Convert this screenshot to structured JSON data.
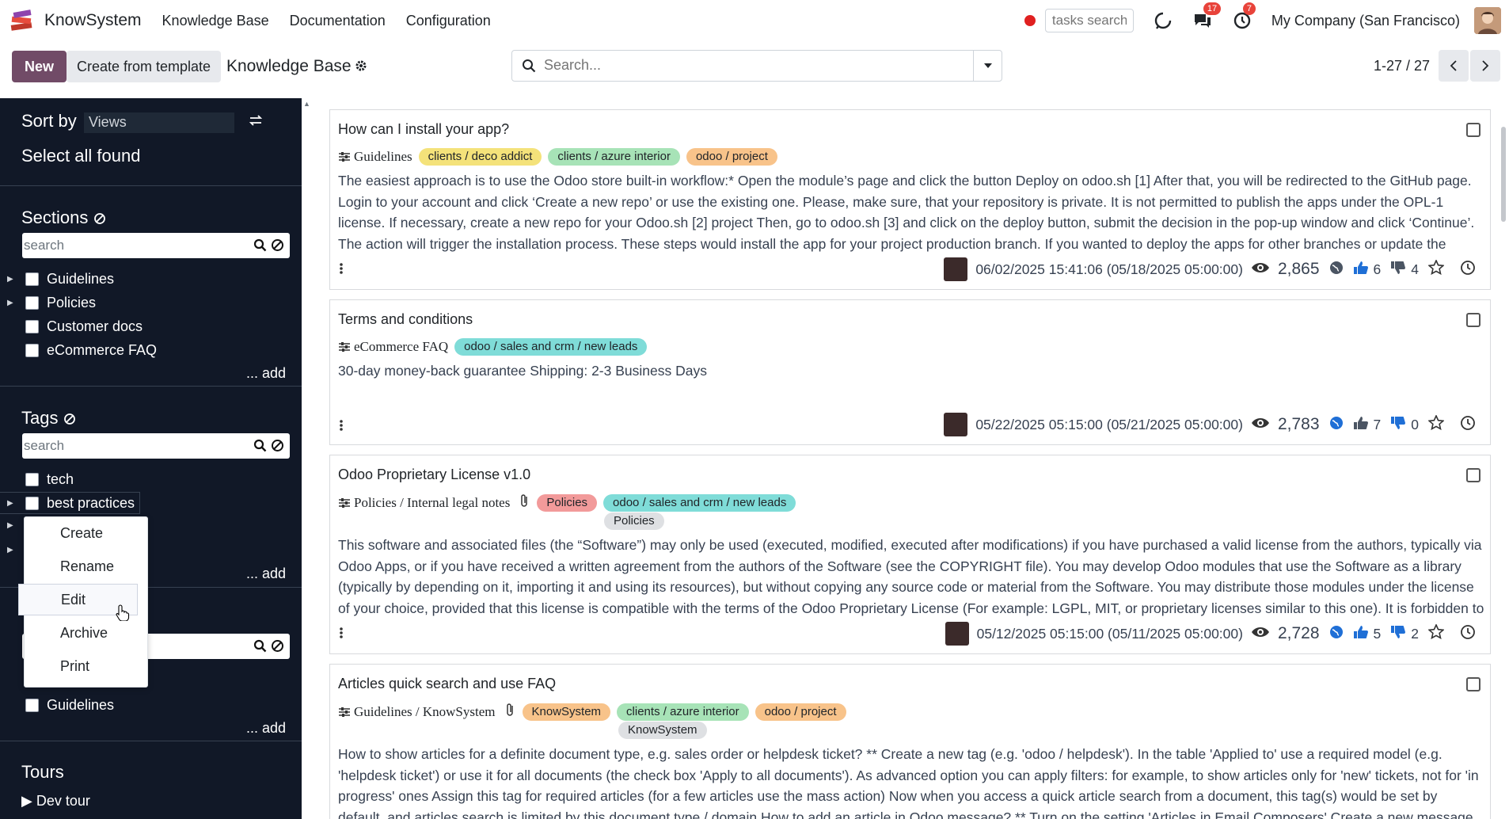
{
  "navbar": {
    "app_name": "KnowSystem",
    "menu": [
      "Knowledge Base",
      "Documentation",
      "Configuration"
    ],
    "tasks_search_placeholder": "tasks search",
    "messages_badge": "17",
    "activities_badge": "7",
    "company": "My Company (San Francisco)"
  },
  "control_panel": {
    "new_label": "New",
    "template_label": "Create from template",
    "breadcrumb": "Knowledge Base",
    "search_placeholder": "Search...",
    "pager": "1-27 / 27"
  },
  "sidebar": {
    "sort_by_label": "Sort by",
    "sort_value": "Views",
    "select_all": "Select all found",
    "sections": {
      "title": "Sections",
      "search_placeholder": "search",
      "items": [
        "Guidelines",
        "Policies",
        "Customer docs",
        "eCommerce FAQ"
      ],
      "add": "... add"
    },
    "tags": {
      "title": "Tags",
      "search_placeholder": "search",
      "items": [
        "tech",
        "best practices"
      ],
      "add": "... add"
    },
    "types": {
      "items": [
        "Guidelines"
      ],
      "add": "... add"
    },
    "tours": {
      "title": "Tours",
      "items": [
        "▶ Dev tour"
      ]
    },
    "context_menu": [
      "Create",
      "Rename",
      "Edit",
      "Archive",
      "Print"
    ]
  },
  "articles": [
    {
      "title": "How can I install your app?",
      "section": "Guidelines",
      "tags": [
        "clients / deco addict",
        "clients / azure interior",
        "odoo / project"
      ],
      "text": "The easiest approach is to use the Odoo store built-in workflow:* Open the module’s page and click the button Deploy on odoo.sh [1] After that, you will be redirected to the GitHub page. Login to your account and click ‘Create a new repo’ or use the existing one. Please, make sure, that your repository is private. It is not permitted to publish the apps under the OPL-1 license. If necessary, create a new repo for your Odoo.sh [2] project Then, go to odoo.sh [3] and click on the deploy button, submit the decision in the pop-up window and click ‘Continue’. The action will trigger the installation process. These steps would install the app for your project production branch. If you wanted to deploy the apps for other branches or update the",
      "dates": "06/02/2025 15:41:06  (05/18/2025 05:00:00)",
      "views": "2,865",
      "likes": "6",
      "dislikes": "4"
    },
    {
      "title": "Terms and conditions",
      "section": "eCommerce FAQ",
      "tags": [
        "odoo / sales and crm / new leads"
      ],
      "text": "30-day money-back guarantee Shipping: 2-3 Business Days",
      "dates": "05/22/2025 05:15:00  (05/21/2025 05:00:00)",
      "views": "2,783",
      "likes": "7",
      "dislikes": "0"
    },
    {
      "title": "Odoo Proprietary License v1.0",
      "section": "Policies / Internal legal notes",
      "tags": [
        "Policies",
        "odoo / sales and crm / new leads"
      ],
      "tags2": [
        "Policies"
      ],
      "text": "This software and associated files (the “Software”) may only be used (executed, modified, executed after modifications) if you have purchased a valid license from the authors, typically via Odoo Apps, or if you have received a written agreement from the authors of the Software (see the COPYRIGHT file). You may develop Odoo modules that use the Software as a library (typically by depending on it, importing it and using its resources), but without copying any source code or material from the Software. You may distribute those modules under the license of your choice, provided that this license is compatible with the terms of the Odoo Proprietary License (For example: LGPL, MIT, or proprietary licenses similar to this one). It is forbidden to",
      "dates": "05/12/2025 05:15:00  (05/11/2025 05:00:00)",
      "views": "2,728",
      "likes": "5",
      "dislikes": "2"
    },
    {
      "title": "Articles quick search and use FAQ",
      "section": "Guidelines / KnowSystem",
      "tags": [
        "KnowSystem",
        "clients / azure interior",
        "odoo / project"
      ],
      "tags2": [
        "KnowSystem"
      ],
      "text": "How to show articles for a definite document type, e.g. sales order or helpdesk ticket? ** Create a new tag (e.g. 'odoo / helpdesk'). In the table 'Applied to' use a required model (e.g. 'helpdesk ticket') or use it for all documents (the check box 'Apply to all documents'). As advanced option you can apply filters: for example, to show articles only for 'new' tickets, not for 'in progress' ones Assign this tag for required articles (for a few articles use the mass action) Now when you access a quick article search from a document, this tag(s) would be set by default, and articles search is limited by this document type / domain How to add an article in Odoo message? ** Turn on the setting 'Articles in Email Composers' Create a new message (e.g."
    }
  ],
  "colors": {
    "brand": "#714b67",
    "sidebar_bg": "#111827",
    "like": "#1f6fd6"
  }
}
